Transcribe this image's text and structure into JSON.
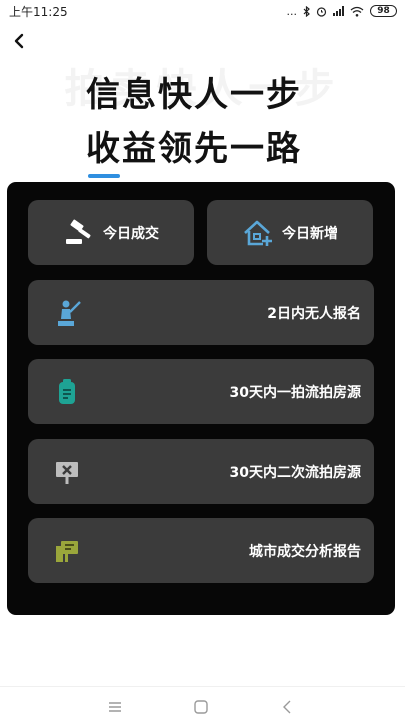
{
  "status_bar": {
    "time": "上午11:25",
    "dots": "...",
    "battery": "98"
  },
  "hero": {
    "watermark": "拍卖快人一步",
    "line1": "信息快人一步",
    "line2": "收益领先一路"
  },
  "cards": {
    "today_deals": "今日成交",
    "today_new": "今日新增",
    "no_bidder": "2日内无人报名",
    "first_failed": "30天内一拍流拍房源",
    "second_failed": "30天内二次流拍房源",
    "city_report": "城市成交分析报告"
  },
  "colors": {
    "accent": "#2f8fe0",
    "panel_bg": "#070707",
    "card_bg": "#3b3b3b",
    "icon_blue": "#5aa7d8",
    "icon_teal": "#1ea394",
    "icon_olive": "#9aa63b"
  },
  "icons": {
    "back": "chevron-left-icon",
    "today_deals": "gavel-icon",
    "today_new": "house-plus-icon",
    "no_bidder": "person-pole-icon",
    "first_failed": "clipboard-icon",
    "second_failed": "sign-x-icon",
    "city_report": "board-icon"
  }
}
